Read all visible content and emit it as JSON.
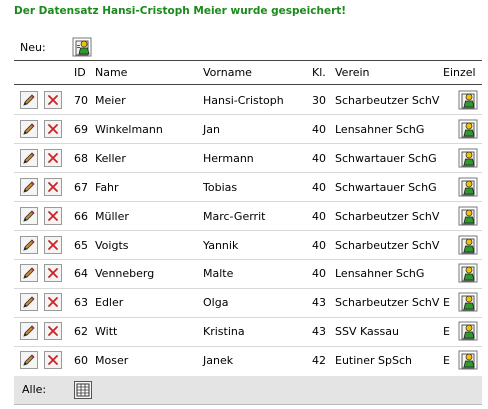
{
  "message": "Der Datensatz Hansi-Cristoph Meier wurde gespeichert!",
  "new_label": "Neu:",
  "all_label": "Alle:",
  "colors": {
    "message": "#1a8a1a",
    "delete_x": "#cc2222",
    "footer_bg": "#e4e4e4"
  },
  "icons": {
    "new": "add-person-icon",
    "edit": "pencil-icon",
    "delete": "delete-x-icon",
    "single": "person-icon",
    "all": "grid-table-icon"
  },
  "columns": {
    "id": "ID",
    "name": "Name",
    "vorname": "Vorname",
    "kl": "Kl.",
    "verein": "Verein",
    "einzel": "Einzel"
  },
  "rows": [
    {
      "id": "70",
      "name": "Meier",
      "vorname": "Hansi-Cristoph",
      "kl": "30",
      "verein": "Scharbeutzer SchV",
      "einzel": ""
    },
    {
      "id": "69",
      "name": "Winkelmann",
      "vorname": "Jan",
      "kl": "40",
      "verein": "Lensahner SchG",
      "einzel": ""
    },
    {
      "id": "68",
      "name": "Keller",
      "vorname": "Hermann",
      "kl": "40",
      "verein": "Schwartauer SchG",
      "einzel": ""
    },
    {
      "id": "67",
      "name": "Fahr",
      "vorname": "Tobias",
      "kl": "40",
      "verein": "Schwartauer SchG",
      "einzel": ""
    },
    {
      "id": "66",
      "name": "Müller",
      "vorname": "Marc-Gerrit",
      "kl": "40",
      "verein": "Scharbeutzer SchV",
      "einzel": ""
    },
    {
      "id": "65",
      "name": "Voigts",
      "vorname": "Yannik",
      "kl": "40",
      "verein": "Scharbeutzer SchV",
      "einzel": ""
    },
    {
      "id": "64",
      "name": "Venneberg",
      "vorname": "Malte",
      "kl": "40",
      "verein": "Lensahner SchG",
      "einzel": ""
    },
    {
      "id": "63",
      "name": "Edler",
      "vorname": "Olga",
      "kl": "43",
      "verein": "Scharbeutzer SchV",
      "einzel": "E"
    },
    {
      "id": "62",
      "name": "Witt",
      "vorname": "Kristina",
      "kl": "43",
      "verein": "SSV Kassau",
      "einzel": "E"
    },
    {
      "id": "60",
      "name": "Moser",
      "vorname": "Janek",
      "kl": "42",
      "verein": "Eutiner SpSch",
      "einzel": "E"
    }
  ]
}
